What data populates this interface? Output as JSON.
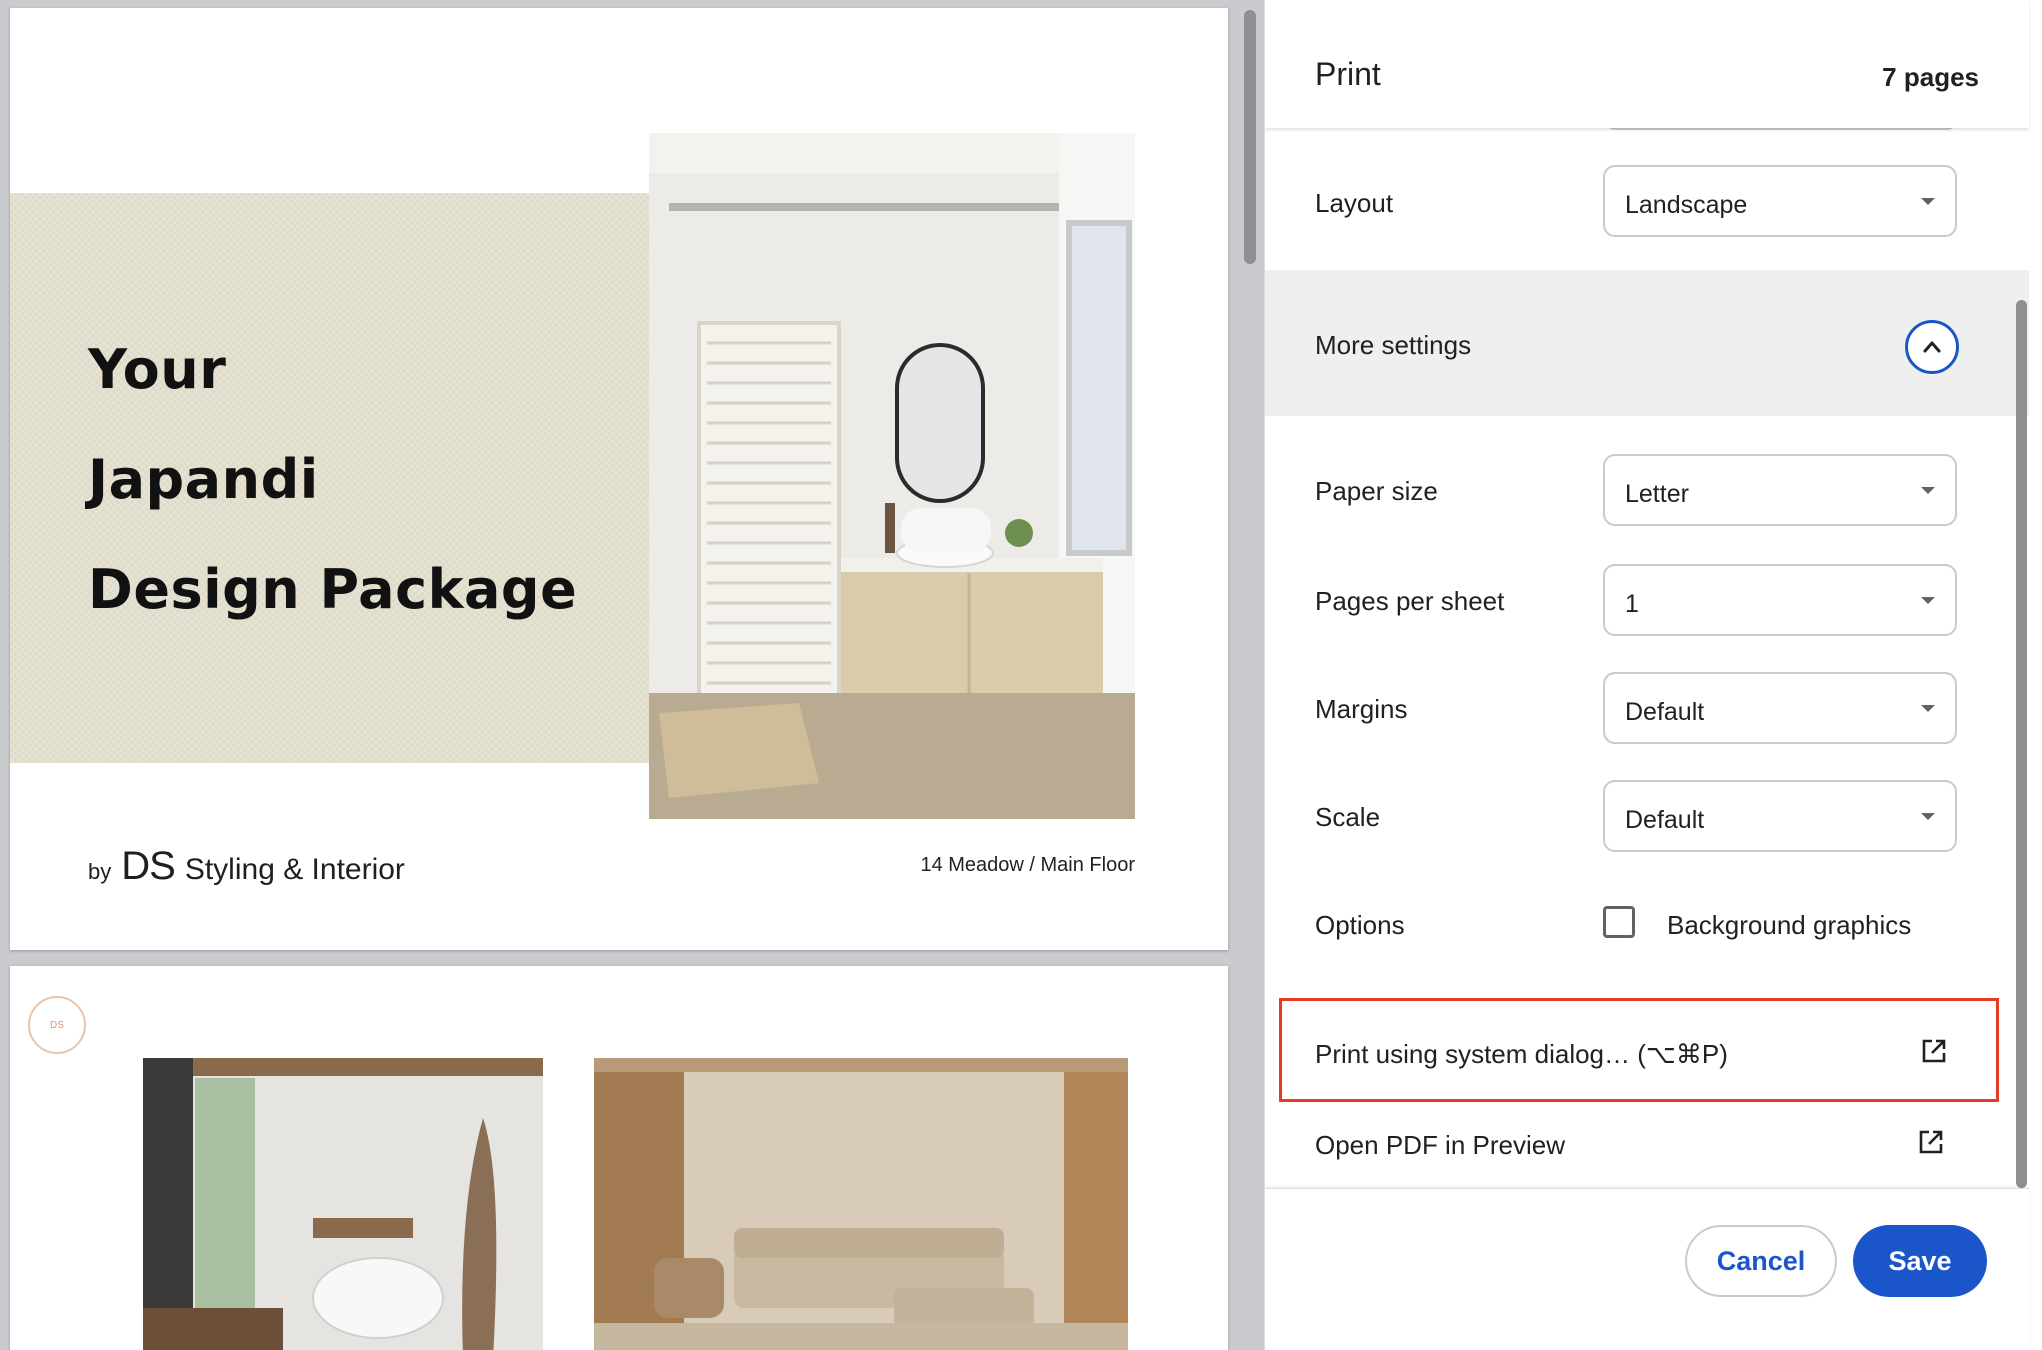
{
  "preview": {
    "page1": {
      "title_lines": [
        "Your",
        "Japandi",
        "Design Package"
      ],
      "brand": {
        "by": "by",
        "logo": "DS",
        "name": "Styling & Interior"
      },
      "address": "14 Meadow / Main Floor"
    },
    "page2": {
      "stamp": "DS"
    }
  },
  "panel": {
    "title": "Print",
    "page_count": "7 pages",
    "layout": {
      "label": "Layout",
      "value": "Landscape"
    },
    "more_settings": {
      "label": "More settings",
      "expanded": true
    },
    "paper_size": {
      "label": "Paper size",
      "value": "Letter"
    },
    "pages_per_sheet": {
      "label": "Pages per sheet",
      "value": "1"
    },
    "margins": {
      "label": "Margins",
      "value": "Default"
    },
    "scale": {
      "label": "Scale",
      "value": "Default"
    },
    "options": {
      "label": "Options",
      "background_graphics": "Background graphics",
      "checked": false
    },
    "system_dialog": {
      "label": "Print using system dialog… (⌥⌘P)",
      "icon": "open-in-new-icon"
    },
    "open_pdf": {
      "label": "Open PDF in Preview",
      "icon": "open-in-new-icon"
    },
    "cancel": "Cancel",
    "save": "Save"
  },
  "colors": {
    "accent": "#1a56c9",
    "highlight": "#e43a26",
    "beige": "#e7e3d3"
  }
}
